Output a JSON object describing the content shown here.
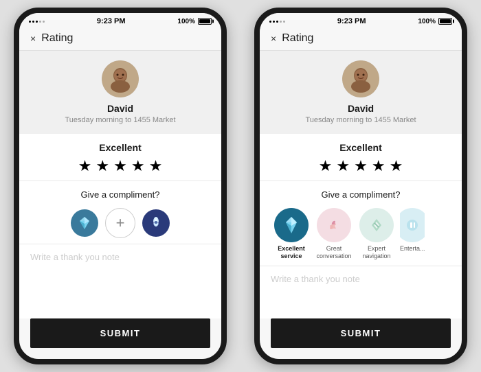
{
  "left_phone": {
    "status": {
      "dots": "●●●○○",
      "time": "9:23 PM",
      "battery": "100%"
    },
    "header": {
      "close_label": "×",
      "title": "Rating"
    },
    "driver": {
      "name": "David",
      "trip": "Tuesday morning to 1455 Market"
    },
    "rating": {
      "label": "Excellent",
      "stars": [
        "★",
        "★",
        "★",
        "★",
        "★"
      ]
    },
    "compliment": {
      "title": "Give a compliment?",
      "add_label": "+"
    },
    "note_placeholder": "Write a thank you note",
    "submit_label": "SUBMIT"
  },
  "right_phone": {
    "status": {
      "time": "9:23 PM",
      "battery": "100%"
    },
    "header": {
      "close_label": "×",
      "title": "Rating"
    },
    "driver": {
      "name": "David",
      "trip": "Tuesday morning to 1455 Market"
    },
    "rating": {
      "label": "Excellent",
      "stars": [
        "★",
        "★",
        "★",
        "★",
        "★"
      ]
    },
    "compliment": {
      "title": "Give a compliment?",
      "items": [
        {
          "label": "Excellent\nservice",
          "active": true,
          "type": "gem"
        },
        {
          "label": "Great\nconversation",
          "active": false,
          "type": "conv"
        },
        {
          "label": "Expert\nnavigation",
          "active": false,
          "type": "nav"
        },
        {
          "label": "Enterta...\ndriv...",
          "active": false,
          "type": "ent"
        }
      ]
    },
    "note_placeholder": "Write a thank you note",
    "submit_label": "SUBMIT"
  },
  "colors": {
    "black": "#1a1a1a",
    "gem_bg": "#1a6a8a",
    "conv_bg": "#f0d0d8",
    "nav_bg": "#d0e8e0",
    "ent_bg": "#c8e8f0"
  }
}
